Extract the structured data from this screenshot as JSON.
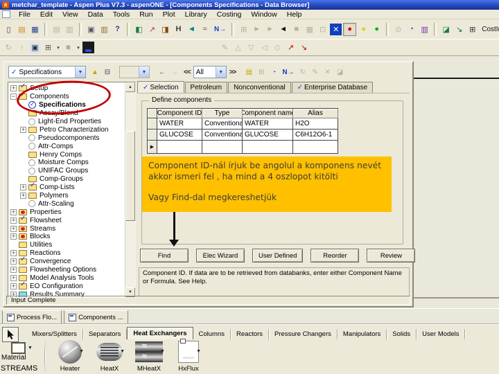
{
  "title_bar": {
    "title": "metchar_template - Aspen Plus V7.3 - aspenONE - [Components Specifications - Data Browser]"
  },
  "menu_bar": {
    "items": [
      "File",
      "Edit",
      "View",
      "Data",
      "Tools",
      "Run",
      "Plot",
      "Library",
      "Costing",
      "Window",
      "Help"
    ]
  },
  "toolbar_main": {
    "items": [
      {
        "name": "new-icon",
        "glyph": "▯",
        "color": "#404040"
      },
      {
        "name": "open-folder-icon",
        "glyph": "▤",
        "color": "#c89018"
      },
      {
        "name": "save-icon",
        "glyph": "▦",
        "color": "#23408e"
      },
      {
        "sep": true
      },
      {
        "name": "print-icon",
        "glyph": "▤",
        "disabled": true
      },
      {
        "name": "print-preview-icon",
        "glyph": "▥",
        "disabled": true
      },
      {
        "sep": true
      },
      {
        "name": "copy-icon",
        "glyph": "▣",
        "color": "#555566"
      },
      {
        "name": "paste-icon",
        "glyph": "▥",
        "color": "#8a6d3b"
      },
      {
        "name": "help-icon",
        "glyph": "?",
        "color": "#23408e",
        "bold": true
      },
      {
        "sep": true
      },
      {
        "name": "flowsheet-plot-icon",
        "glyph": "◧",
        "color": "#188038"
      },
      {
        "name": "stream-tool-icon",
        "glyph": "↗",
        "color": "#b03060"
      },
      {
        "name": "block-tool-icon",
        "glyph": "◨",
        "color": "#884400"
      },
      {
        "name": "heat-stream-icon",
        "glyph": "H",
        "color": "#404040",
        "bold": true
      },
      {
        "name": "rotate-icon",
        "glyph": "◄",
        "color": "#008080"
      },
      {
        "name": "work-stream-icon",
        "glyph": "≈",
        "color": "#555566"
      },
      {
        "name": "next-input-icon",
        "glyph": "N→",
        "color": "#1040c0",
        "bold": true,
        "text": true
      },
      {
        "sep": true
      },
      {
        "name": "data-browser-icon",
        "glyph": "⊞",
        "disabled": true
      },
      {
        "name": "run-icon",
        "glyph": "►",
        "disabled": true
      },
      {
        "name": "step-icon",
        "glyph": "►",
        "disabled": true
      },
      {
        "name": "step-back-icon",
        "glyph": "◄",
        "color": "#111111"
      },
      {
        "name": "stop-icon",
        "glyph": "■",
        "disabled": true
      },
      {
        "name": "control-panel-icon",
        "glyph": "▦",
        "disabled": true
      },
      {
        "name": "reinitialize-icon",
        "glyph": "⊡",
        "disabled": true
      },
      {
        "name": "excel-icon",
        "glyph": "✕",
        "color": "#ffffff",
        "bg": "#1040c0"
      },
      {
        "name": "status-red-icon",
        "glyph": "●",
        "color": "#d40000",
        "pressed": true
      },
      {
        "name": "status-yellow-icon",
        "glyph": "●",
        "color": "#ddd400"
      },
      {
        "name": "status-green-icon",
        "glyph": "●",
        "color": "#00b400"
      },
      {
        "sep": true
      },
      {
        "name": "capture-icon",
        "glyph": "⊙",
        "disabled": true
      },
      {
        "name": "history-clock-icon",
        "glyph": "◔",
        "color": "#2255aa"
      },
      {
        "name": "tps-icon",
        "glyph": "▥",
        "color": "#7030a0"
      },
      {
        "sep": true
      },
      {
        "name": "plot-wizard-icon",
        "glyph": "◪",
        "color": "#188038"
      },
      {
        "name": "annotate-plot-icon",
        "glyph": "↘",
        "color": "#0a6a5a"
      },
      {
        "name": "table-grid-icon",
        "glyph": "⊞",
        "color": "#333333"
      },
      {
        "name": "costing-label",
        "glyph": "CostIn",
        "color": "#111111",
        "text": true
      }
    ]
  },
  "toolbar_secondary": {
    "left_items": [
      {
        "name": "redraw-icon",
        "glyph": "↻",
        "disabled": true
      },
      {
        "name": "up-level-icon",
        "glyph": "↑",
        "disabled": true
      },
      {
        "name": "view-screen-icon",
        "glyph": "▣",
        "color": "#223344",
        "bg": "#e0e4ee"
      },
      {
        "name": "window-layout-icon",
        "glyph": "⊞",
        "color": "#555566"
      },
      {
        "name": "dropdown-arrow-icon",
        "glyph": "▾",
        "color": "#333333",
        "narrow": true
      },
      {
        "name": "list-view-icon",
        "glyph": "≡",
        "color": "#555566"
      },
      {
        "name": "dropdown-arrow-icon",
        "glyph": "▾",
        "color": "#333333",
        "narrow": true
      },
      {
        "name": "3d-view-icon",
        "glyph": "▂",
        "color": "#3355ff",
        "bg": "#1a1a1a"
      }
    ],
    "right_items": [
      {
        "name": "pencil-icon",
        "glyph": "✎",
        "disabled": true
      },
      {
        "name": "shape-triangle-icon",
        "glyph": "△",
        "disabled": true
      },
      {
        "name": "shape-down-icon",
        "glyph": "▽",
        "disabled": true
      },
      {
        "name": "shape-left-icon",
        "glyph": "◁",
        "disabled": true
      },
      {
        "name": "shape-diamond-icon",
        "glyph": "◇",
        "disabled": true
      },
      {
        "name": "draw-arrow-icon",
        "glyph": "↗",
        "color": "#c00000"
      },
      {
        "name": "draw-arrow2-icon",
        "glyph": "↘",
        "color": "#c00000"
      }
    ]
  },
  "data_browser": {
    "nav_check_glyph": "✓",
    "nav_value": "Specifications",
    "range_value": "All",
    "back_glyph": "←",
    "forward_glyph": "→",
    "prev_sheet_glyph": "<<",
    "next_sheet_glyph": ">>",
    "mid_icons": [
      {
        "name": "new-folder-icon",
        "glyph": "▲",
        "color": "#c8a000"
      },
      {
        "name": "tree-view-icon",
        "glyph": "⊟",
        "color": "#444455"
      }
    ],
    "right_icons": [
      {
        "name": "comments-icon",
        "glyph": "▤",
        "color": "#c8a000"
      },
      {
        "name": "compare-icon",
        "glyph": "⊞",
        "disabled": true
      },
      {
        "name": "clock-icon",
        "glyph": "◔",
        "color": "#2266cc"
      },
      {
        "name": "next-input-icon",
        "glyph": "N→",
        "color": "#1040c0",
        "bold": true,
        "text": true
      },
      {
        "name": "refresh-icon",
        "glyph": "↻",
        "disabled": true
      },
      {
        "name": "edit-icon",
        "glyph": "✎",
        "disabled": true
      },
      {
        "name": "delete-icon",
        "glyph": "✕",
        "disabled": true
      },
      {
        "name": "plot-icon",
        "glyph": "◪",
        "disabled": true
      }
    ],
    "tree": {
      "items": [
        {
          "expander": "plus",
          "icon": "folder-check",
          "label": "Setup",
          "depth": 1
        },
        {
          "expander": "minus",
          "icon": "folder-check",
          "label": "Components",
          "depth": 1
        },
        {
          "expander": "none",
          "icon": "check-circle",
          "label": "Specifications",
          "depth": 2,
          "bold": true,
          "selected": true
        },
        {
          "expander": "none",
          "icon": "folder",
          "label": "Assay/Blend",
          "depth": 2
        },
        {
          "expander": "none",
          "icon": "circle",
          "label": "Light-End Properties",
          "depth": 2
        },
        {
          "expander": "plus",
          "icon": "folder",
          "label": "Petro Characterization",
          "depth": 2
        },
        {
          "expander": "none",
          "icon": "circle",
          "label": "Pseudocomponents",
          "depth": 2
        },
        {
          "expander": "none",
          "icon": "circle",
          "label": "Attr-Comps",
          "depth": 2
        },
        {
          "expander": "none",
          "icon": "folder",
          "label": "Henry Comps",
          "depth": 2
        },
        {
          "expander": "none",
          "icon": "circle",
          "label": "Moisture Comps",
          "depth": 2
        },
        {
          "expander": "none",
          "icon": "circle",
          "label": "UNIFAC Groups",
          "depth": 2
        },
        {
          "expander": "none",
          "icon": "folder",
          "label": "Comp-Groups",
          "depth": 2
        },
        {
          "expander": "plus",
          "icon": "folder-check",
          "label": "Comp-Lists",
          "depth": 2
        },
        {
          "expander": "plus",
          "icon": "folder",
          "label": "Polymers",
          "depth": 2
        },
        {
          "expander": "none",
          "icon": "circle",
          "label": "Attr-Scaling",
          "depth": 2
        },
        {
          "expander": "plus",
          "icon": "folder-red",
          "label": "Properties",
          "depth": 1
        },
        {
          "expander": "plus",
          "icon": "folder-check",
          "label": "Flowsheet",
          "depth": 1
        },
        {
          "expander": "plus",
          "icon": "folder-red",
          "label": "Streams",
          "depth": 1
        },
        {
          "expander": "plus",
          "icon": "folder-red",
          "label": "Blocks",
          "depth": 1
        },
        {
          "expander": "none",
          "icon": "folder",
          "label": "Utilities",
          "depth": 1
        },
        {
          "expander": "plus",
          "icon": "folder",
          "label": "Reactions",
          "depth": 1
        },
        {
          "expander": "plus",
          "icon": "folder-check",
          "label": "Convergence",
          "depth": 1
        },
        {
          "expander": "plus",
          "icon": "folder",
          "label": "Flowsheeting Options",
          "depth": 1
        },
        {
          "expander": "plus",
          "icon": "folder",
          "label": "Model Analysis Tools",
          "depth": 1
        },
        {
          "expander": "plus",
          "icon": "folder-check",
          "label": "EO Configuration",
          "depth": 1
        },
        {
          "expander": "plus",
          "icon": "folder-cyan",
          "label": "Results Summary",
          "depth": 1
        }
      ]
    },
    "tabs": [
      {
        "label": "Selection",
        "checked": true,
        "active": true
      },
      {
        "label": "Petroleum"
      },
      {
        "label": "Nonconventional"
      },
      {
        "label": "Enterprise Database",
        "checked": true
      }
    ],
    "group_title": "Define components",
    "table": {
      "columns": [
        "Component ID",
        "Type",
        "Component name",
        "Alias"
      ],
      "rows": [
        {
          "id": "WATER",
          "type": "Conventional",
          "name": "WATER",
          "alias": "H2O"
        },
        {
          "id": "GLUCOSE",
          "type": "Conventional",
          "name": "GLUCOSE",
          "alias": "C6H12O6-1"
        },
        {
          "id": "",
          "type": "",
          "name": "",
          "alias": "",
          "marker": true
        }
      ]
    },
    "buttons": [
      {
        "label": "Find"
      },
      {
        "label": "Elec Wizard"
      },
      {
        "label": "User Defined"
      },
      {
        "label": "Reorder"
      },
      {
        "label": "Review"
      }
    ],
    "message": "Component ID. If data are to be retrieved from databanks, enter either Component Name or Formula. See Help.",
    "status": "Input Complete"
  },
  "annotations": {
    "note_line1": "Component ID-nál írjuk be angolul a komponens nevét",
    "note_line2": "akkor ismeri fel , ha mind a 4 oszlopot kitölti",
    "note_line3": "Vagy Find-dal megkereshetjük",
    "note_bg": "#FFC000",
    "ellipse_color": "#C00000"
  },
  "bottom": {
    "window_tabs": [
      {
        "label": "Process Flo...",
        "icon": "flowsheet"
      },
      {
        "label": "Components ..."
      }
    ],
    "library": {
      "tabs": [
        {
          "label": "Mixers/Splitters"
        },
        {
          "label": "Separators"
        },
        {
          "label": "Heat Exchangers",
          "active": true
        },
        {
          "label": "Columns"
        },
        {
          "label": "Reactors"
        },
        {
          "label": "Pressure Changers"
        },
        {
          "label": "Manipulators"
        },
        {
          "label": "Solids"
        },
        {
          "label": "User Models"
        }
      ],
      "stream_top_label": "Material",
      "stream_bottom_label": "STREAMS",
      "models": [
        {
          "label": "Heater",
          "icon": "heater"
        },
        {
          "label": "HeatX",
          "icon": "heatx"
        },
        {
          "label": "MHeatX",
          "icon": "mheatx"
        },
        {
          "label": "HxFlux",
          "icon": "hxflux",
          "icon_text": "HXFLUX"
        }
      ]
    }
  }
}
